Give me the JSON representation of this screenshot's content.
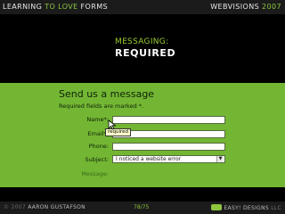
{
  "header": {
    "title_part1": "LEARNING ",
    "title_highlight": "TO LOVE",
    "title_part2": " FORMS",
    "event": "WEBVISIONS",
    "year": "2007"
  },
  "slide": {
    "kicker": "MESSAGING:",
    "title": "REQUIRED"
  },
  "form": {
    "heading": "Send us a message",
    "note": "Required fields are marked *.",
    "fields": {
      "name_label": "Name*:",
      "email_label": "Email*:",
      "phone_label": "Phone:",
      "subject_label": "Subject:",
      "subject_value": "I noticed a website error",
      "message_label": "Message:"
    },
    "tooltip": "required"
  },
  "footer": {
    "copyright_year": "2007",
    "author": "AARON GUSTAFSON",
    "slide_number": "78/75",
    "company": "EASY! DESIGNS",
    "suffix": "LLC"
  },
  "colors": {
    "accent": "#8dc63f",
    "panel": "#73b633"
  }
}
